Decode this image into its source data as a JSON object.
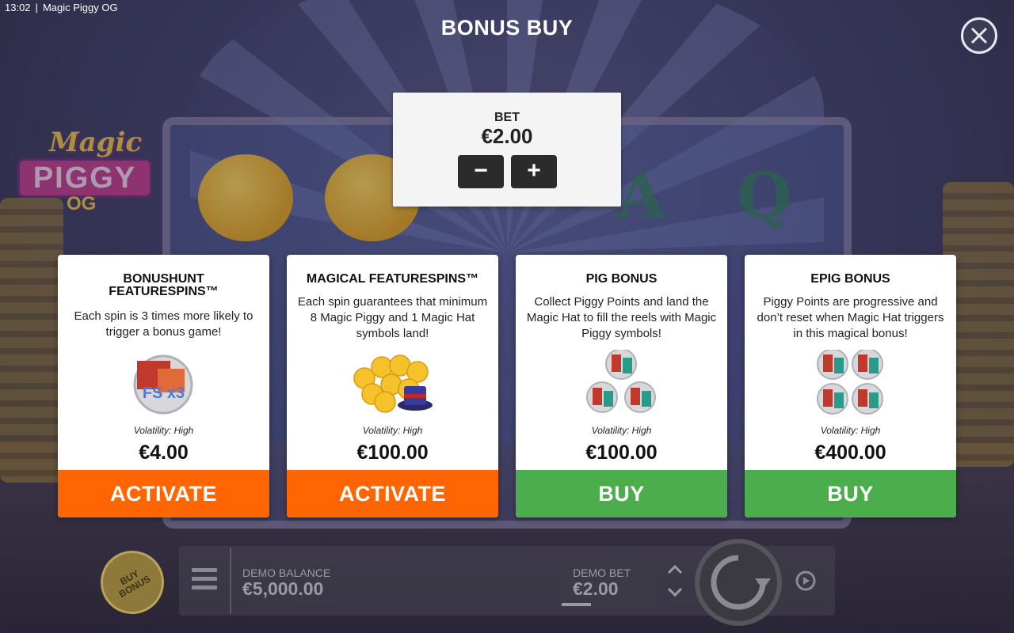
{
  "status_bar": {
    "time": "13:02",
    "app_name": "Magic Piggy OG"
  },
  "logo": {
    "line1": "Magic",
    "line2": "PIGGY",
    "line3": "OG"
  },
  "background_symbols": [
    "A",
    "Q"
  ],
  "dialog": {
    "title": "BONUS BUY",
    "close_icon": "close-icon"
  },
  "bet_panel": {
    "label": "BET",
    "value": "€2.00",
    "minus": "−",
    "plus": "+"
  },
  "cards": [
    {
      "title": "BONUSHUNT FEATURESPINS™",
      "description": "Each spin is 3 times more likely to trigger a bonus game!",
      "art": "fs-x3-icon",
      "art_text": "FS x3",
      "volatility": "Volatility: High",
      "price": "€4.00",
      "button": "ACTIVATE",
      "button_color": "#ff6500"
    },
    {
      "title": "MAGICAL FEATURESPINS™",
      "description": "Each spin guarantees that minimum 8 Magic Piggy and 1 Magic Hat symbols land!",
      "art": "piggies-and-hat-icon",
      "volatility": "Volatility: High",
      "price": "€100.00",
      "button": "ACTIVATE",
      "button_color": "#ff6500"
    },
    {
      "title": "PIG BONUS",
      "description": "Collect Piggy Points and land the Magic Hat to fill the reels with Magic Piggy symbols!",
      "art": "three-fs-coins-icon",
      "volatility": "Volatility: High",
      "price": "€100.00",
      "button": "BUY",
      "button_color": "#4cad4c"
    },
    {
      "title": "EPIG BONUS",
      "description": "Piggy Points are progressive and don’t reset when Magic Hat triggers in this magical bonus!",
      "art": "four-fs-coins-icon",
      "volatility": "Volatility: High",
      "price": "€400.00",
      "button": "BUY",
      "button_color": "#4cad4c"
    }
  ],
  "bottom_bar": {
    "buy_bonus": "BUY BONUS",
    "balance_label": "DEMO BALANCE",
    "balance_value": "€5,000.00",
    "bet_label": "DEMO BET",
    "bet_value": "€2.00"
  }
}
